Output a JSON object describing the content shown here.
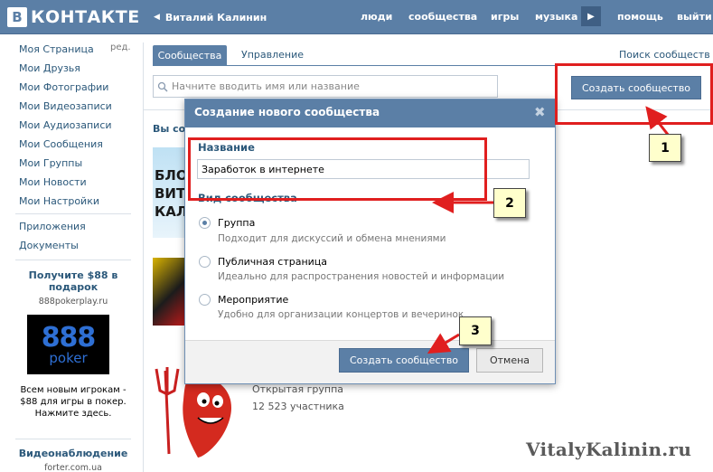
{
  "header": {
    "logo_box": "В",
    "logo_text": "КОНТАКТЕ",
    "user_name": "Виталий Калинин",
    "user_arrow_icon": "chevron-left-icon",
    "nav": [
      "люди",
      "сообщества",
      "игры",
      "музыка",
      "помощь",
      "выйти"
    ]
  },
  "sidebar": {
    "edit": "ред.",
    "items": [
      "Моя Страница",
      "Мои Друзья",
      "Мои Фотографии",
      "Мои Видеозаписи",
      "Мои Аудиозаписи",
      "Мои Сообщения",
      "Мои Группы",
      "Мои Новости",
      "Мои Настройки"
    ],
    "extra_items": [
      "Приложения",
      "Документы"
    ],
    "ad": {
      "title": "Получите $88 в подарок",
      "domain": "888pokerplay.ru",
      "image_number": "888",
      "image_word": "poker",
      "text": "Всем новым игрокам - $88 для игры в покер. Нажмите здесь."
    },
    "ad2": {
      "title": "Видеонаблюдение",
      "domain": "forter.com.ua"
    }
  },
  "main": {
    "tab_communities": "Сообщества",
    "tab_manage": "Управление",
    "search_communities": "Поиск сообществ",
    "search_placeholder": "Начните вводить имя или название",
    "create_button": "Создать сообщество",
    "your_communities": "Вы со",
    "thumb1_text": [
      "БЛО",
      "ВИТ",
      "КАЛ"
    ],
    "group3_type": "Открытая группа",
    "group3_members": "12 523 участника"
  },
  "dialog": {
    "title": "Создание нового сообщества",
    "close": "✖",
    "name_label": "Название",
    "name_value": "Заработок в интернете",
    "type_label": "Вид сообщества",
    "options": [
      {
        "title": "Группа",
        "desc": "Подходит для дискуссий и обмена мнениями",
        "checked": true
      },
      {
        "title": "Публичная страница",
        "desc": "Идеально для распространения новостей и информации",
        "checked": false
      },
      {
        "title": "Мероприятие",
        "desc": "Удобно для организации концертов и вечеринок",
        "checked": false
      }
    ],
    "create_button": "Создать сообщество",
    "cancel_button": "Отмена"
  },
  "annotations": {
    "callouts": [
      "1",
      "2",
      "3"
    ],
    "color": "#e01f1f"
  },
  "watermark": "VitalyKalinin.ru",
  "colors": {
    "brand": "#5b7fa6",
    "link": "#2b587a",
    "annotation": "#e01f1f",
    "callout_bg": "#ffffcc"
  }
}
